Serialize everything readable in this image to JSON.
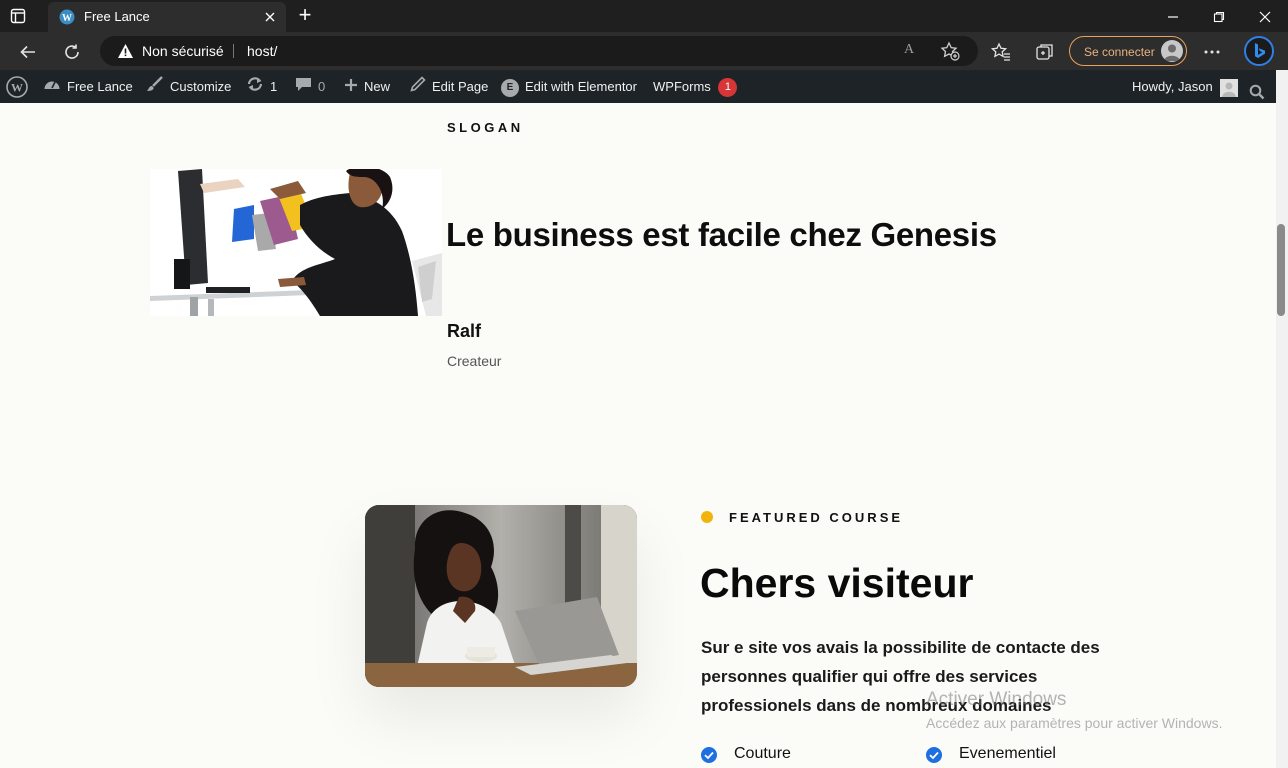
{
  "browser": {
    "tab_title": "Free Lance",
    "new_tab_symbol": "+",
    "security_label": "Non sécurisé",
    "url": "host/",
    "signin_label": "Se connecter",
    "read_aloud_glyph": "A",
    "accent_color": "#e8a25b"
  },
  "adminbar": {
    "site_name": "Free Lance",
    "customize": "Customize",
    "updates_count": "1",
    "comments_count": "0",
    "new": "New",
    "edit_page": "Edit Page",
    "edit_elementor": "Edit with Elementor",
    "elementor_badge": "E",
    "wpforms": "WPForms",
    "wpforms_badge": "1",
    "howdy": "Howdy, Jason"
  },
  "testimonial": {
    "slogan": "SLOGAN",
    "quote": "Le business est facile chez Genesis",
    "author": "Ralf",
    "role": "Createur"
  },
  "course": {
    "label": "FEATURED COURSE",
    "title": "Chers visiteur",
    "description": "Sur e site vos avais la possibilite de contacte des personnes qualifier qui offre des services professionels dans de nombreux domaines",
    "features": [
      "Couture",
      "Evenementiel"
    ],
    "dot_color": "#f0b40d",
    "check_color": "#1e6fe0"
  },
  "watermark": {
    "title": "Activer Windows",
    "subtitle": "Accédez aux paramètres pour activer Windows."
  }
}
